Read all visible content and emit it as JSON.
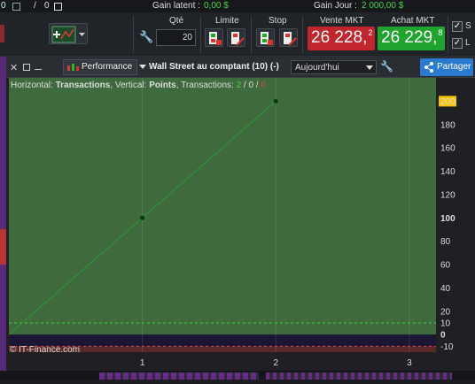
{
  "topbar": {
    "counter_a": "0",
    "separator": "/",
    "counter_b": "0",
    "gain_latent_label": "Gain latent :",
    "gain_latent_value": "0,00 $",
    "gain_jour_label": "Gain Jour :",
    "gain_jour_value": "2 000,00 $"
  },
  "toolbar": {
    "qty_label": "Qté",
    "qty_value": "20",
    "limit_label": "Limite",
    "stop_label": "Stop",
    "sell_label": "Vente MKT",
    "sell_price_main": "26 228,",
    "sell_price_sup": "2",
    "buy_label": "Achat MKT",
    "buy_price_main": "26 229,",
    "buy_price_sup": "8",
    "check_s": "S",
    "check_l": "L"
  },
  "window": {
    "performance_label": "Performance",
    "instrument_label": "Wall Street au comptant (10) (-)",
    "period_value": "Aujourd'hui",
    "share_label": "Partager"
  },
  "chart_info": {
    "horizontal_label": "Horizontal: ",
    "horizontal_value": "Transactions",
    "vertical_label": ", Vertical: ",
    "vertical_value": "Points",
    "transactions_label": ", Transactions: ",
    "tx_win": "2",
    "tx_sep1": " / ",
    "tx_neutral": "0",
    "tx_sep2": " / ",
    "tx_loss": "0",
    "watermark": "© IT-Finance.com"
  },
  "colors": {
    "positive_area": "#3e6a3e",
    "line": "#2f9a2f",
    "point": "#0a3a0a",
    "sell": "#c0262b",
    "buy": "#1fa52d",
    "share": "#2a7ad0",
    "accent_green": "#4cd04c",
    "accent_red": "#e04040",
    "highlight_box": "#f5c400"
  },
  "chart_data": {
    "type": "line",
    "x": [
      0,
      1,
      2
    ],
    "values": [
      0,
      100,
      200
    ],
    "xlim": [
      0,
      3.2
    ],
    "ylim": [
      -15,
      220
    ],
    "x_ticks": [
      "1",
      "2",
      "3"
    ],
    "y_ticks": [
      "200",
      "180",
      "160",
      "140",
      "120",
      "100",
      "80",
      "60",
      "40",
      "20",
      "10",
      "0",
      "-10"
    ],
    "y_tick_values": [
      200,
      180,
      160,
      140,
      120,
      100,
      80,
      60,
      40,
      20,
      10,
      0,
      -10
    ],
    "highlighted_y_tick": "200",
    "bold_y_ticks": [
      "100",
      "0"
    ],
    "reference_lines": [
      10,
      -10
    ]
  }
}
